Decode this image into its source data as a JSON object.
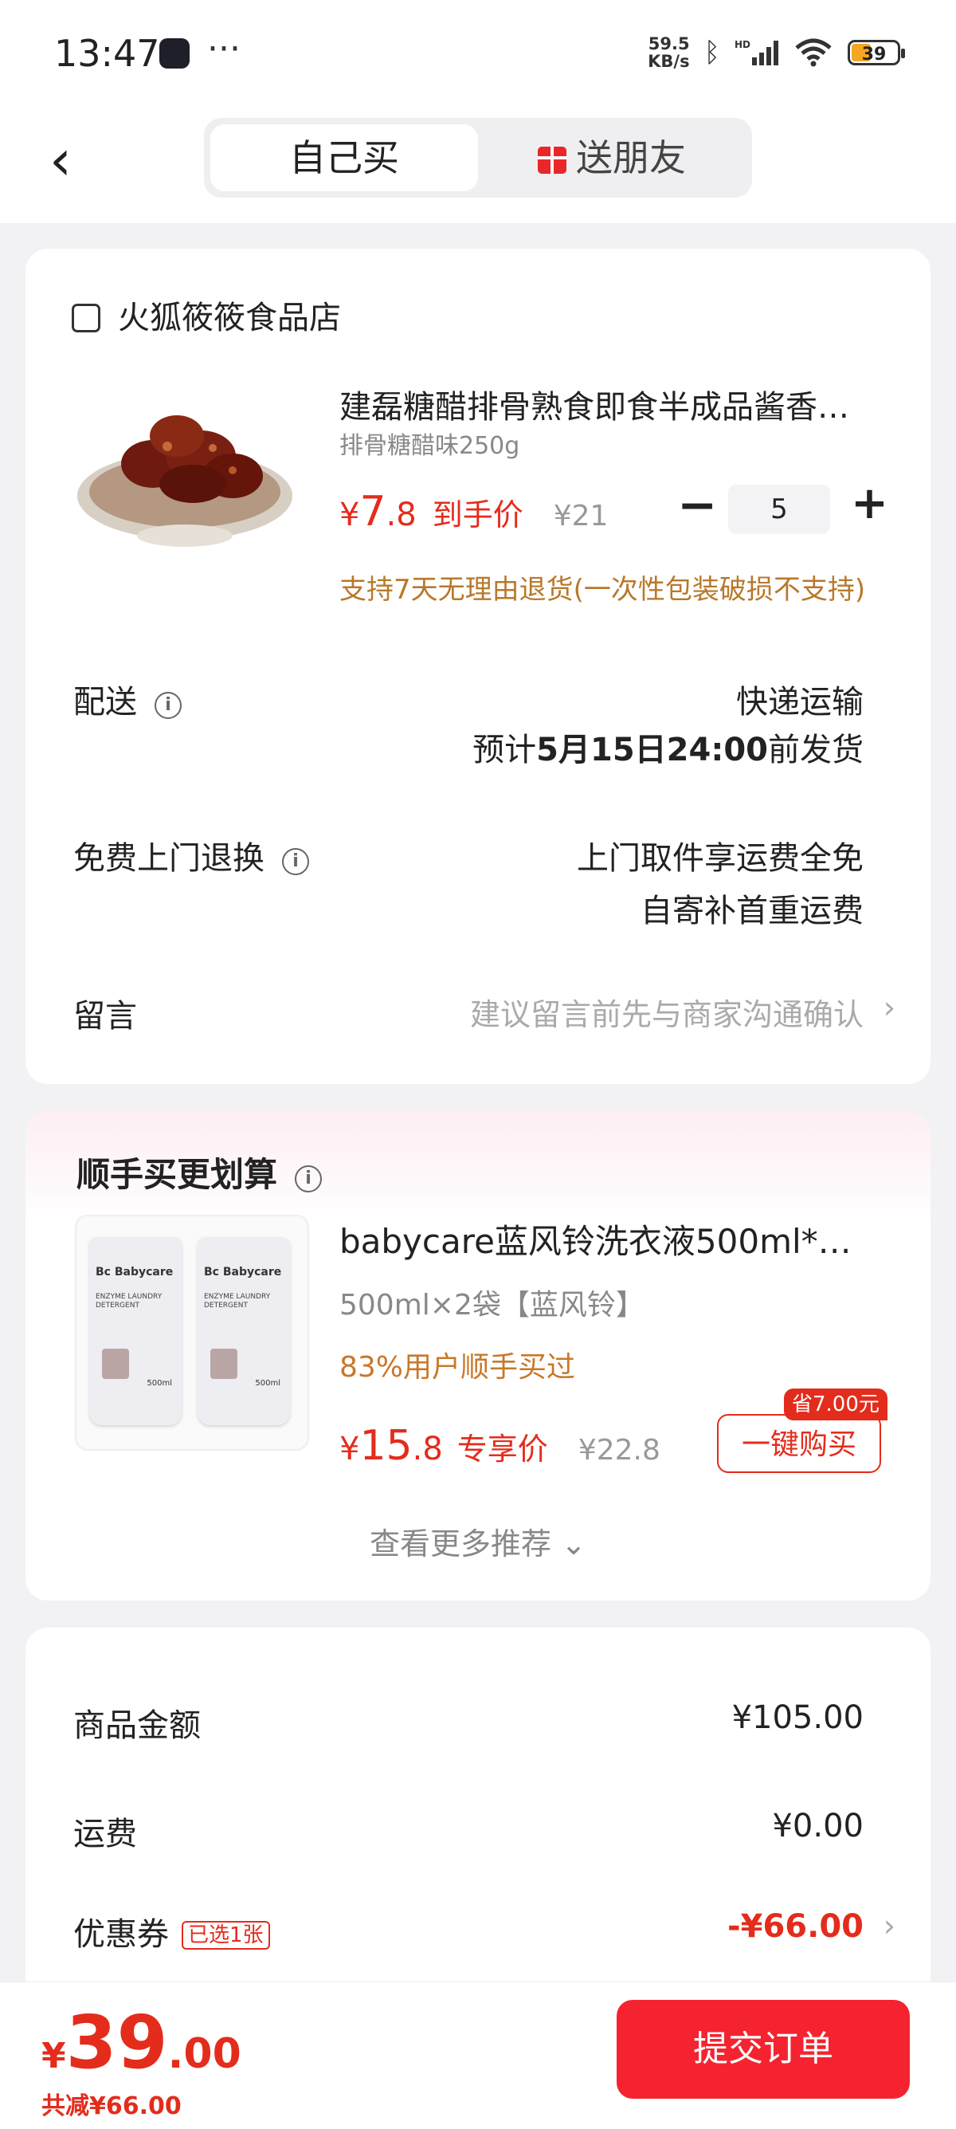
{
  "status_bar": {
    "time": "13:47",
    "net_speed_value": "59.5",
    "net_speed_unit": "KB/s",
    "battery": "39"
  },
  "header": {
    "tabs": [
      {
        "label": "自己买"
      },
      {
        "label": "送朋友"
      }
    ]
  },
  "order_item": {
    "store_name": "火狐筱筱食品店",
    "title": "建磊糖醋排骨熟食即食半成品酱香…",
    "spec": "排骨糖醋味250g",
    "price_symbol": "¥",
    "price_int": "7",
    "price_dec": ".8",
    "price_label": "到手价",
    "original_price": "¥21",
    "quantity": "5",
    "return_note": "支持7天无理由退货(一次性包装破损不支持)"
  },
  "delivery": {
    "label": "配送",
    "method": "快递运输",
    "eta_prefix": "预计",
    "eta_date": "5月15日24:00",
    "eta_suffix": "前发货"
  },
  "free_return": {
    "label": "免费上门退换",
    "line1": "上门取件享运费全免",
    "line2": "自寄补首重运费"
  },
  "message": {
    "label": "留言",
    "placeholder": "建议留言前先与商家沟通确认"
  },
  "recommend": {
    "title": "顺手买更划算",
    "name": "babycare蓝风铃洗衣液500ml*…",
    "spec": "500ml×2袋【蓝风铃】",
    "bought": "83%用户顺手买过",
    "price_symbol": "¥",
    "price_int": "15",
    "price_dec": ".8",
    "price_label": "专享价",
    "original_price": "¥22.8",
    "save_badge": "省7.00元",
    "buy_label": "一键购买",
    "more_label": "查看更多推荐",
    "pouch_brand": "Bc Babycare",
    "pouch_sub": "ENZYME LAUNDRY DETERGENT",
    "pouch_vol": "500ml"
  },
  "summary": {
    "goods_label": "商品金额",
    "goods_value": "¥105.00",
    "shipping_label": "运费",
    "shipping_value": "¥0.00",
    "coupon_label": "优惠券",
    "coupon_badge": "已选1张",
    "coupon_value": "-¥66.00"
  },
  "bottom_bar": {
    "currency": "¥",
    "total_int": "39",
    "total_dec": ".00",
    "saved": "共减¥66.00",
    "submit_label": "提交订单"
  }
}
